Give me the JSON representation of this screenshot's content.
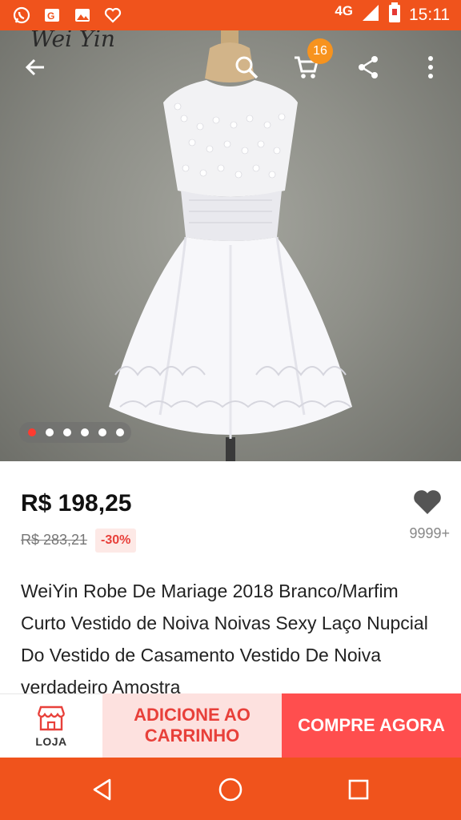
{
  "status_bar": {
    "notification_icons": [
      "whatsapp-icon",
      "google-news-icon",
      "gallery-icon",
      "heart-app-icon"
    ],
    "network": "4G",
    "time": "15:11",
    "bar_color": "#f0531c"
  },
  "top_bar": {
    "brand_watermark": "Wei Yin",
    "cart_count": "16",
    "badge_color": "#f7931e"
  },
  "gallery": {
    "image": "white-short-wedding-dress-on-mannequin",
    "image_count": 6,
    "active_index": 0
  },
  "product": {
    "price": "R$ 198,25",
    "original_price": "R$ 283,21",
    "discount": "-30%",
    "wish_count": "9999+",
    "title": "WeiYin Robe De Mariage 2018 Branco/Marfim Curto Vestido de Noiva Noivas Sexy Laço Nupcial Do Vestido de Casamento Vestido De Noiva verdadeiro Amostra"
  },
  "actions": {
    "store_label": "LOJA",
    "add_to_cart_label": "ADICIONE AO CARRINHO",
    "buy_now_label": "COMPRE AGORA",
    "accent_color": "#ff4e4e"
  }
}
